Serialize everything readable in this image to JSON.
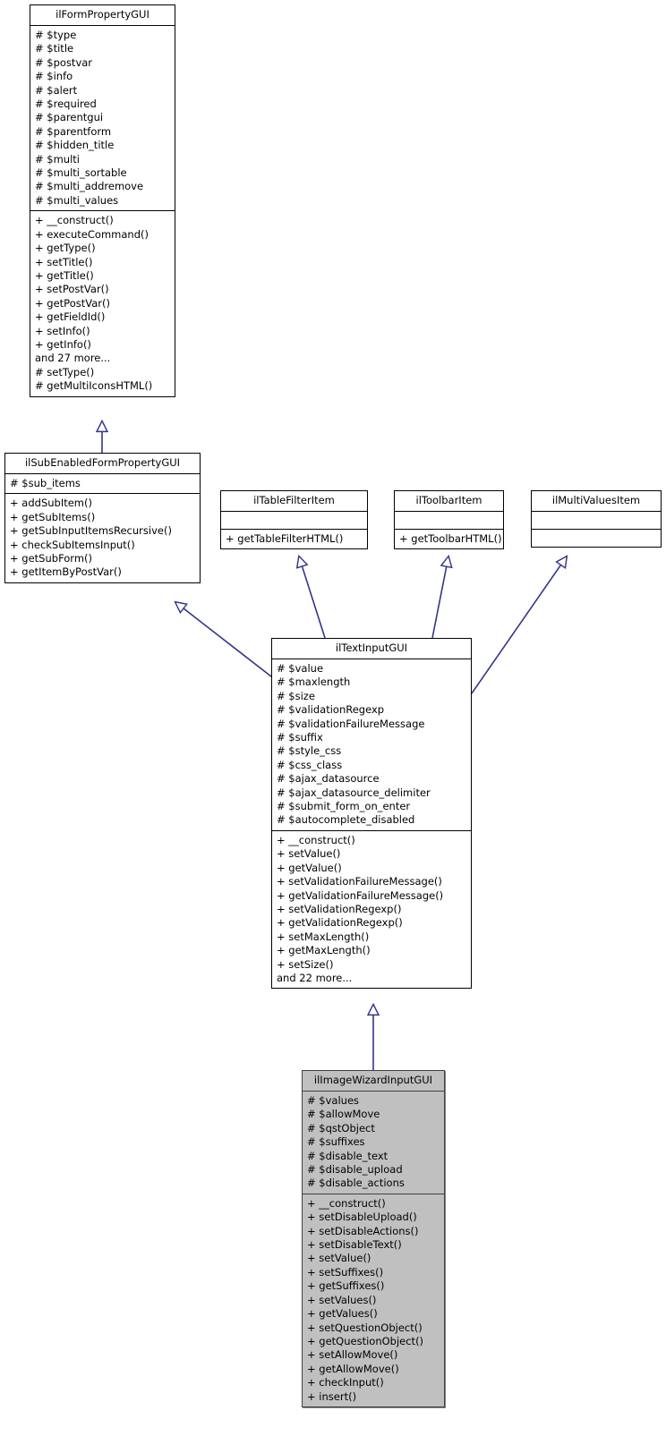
{
  "diagram": {
    "type": "uml-class-inheritance-diagram",
    "edge_color": "#34348c",
    "highlight_fill": "#c0c0c0"
  },
  "classes": [
    {
      "id": "ilFormPropertyGUI",
      "name": "ilFormPropertyGUI",
      "highlight": false,
      "attributes": [
        "# $type",
        "# $title",
        "# $postvar",
        "# $info",
        "# $alert",
        "# $required",
        "# $parentgui",
        "# $parentform",
        "# $hidden_title",
        "# $multi",
        "# $multi_sortable",
        "# $multi_addremove",
        "# $multi_values"
      ],
      "methods": [
        "+ __construct()",
        "+ executeCommand()",
        "+ getType()",
        "+ setTitle()",
        "+ getTitle()",
        "+ setPostVar()",
        "+ getPostVar()",
        "+ getFieldId()",
        "+ setInfo()",
        "+ getInfo()",
        "and 27 more...",
        "# setType()",
        "# getMultiIconsHTML()"
      ]
    },
    {
      "id": "ilSubEnabledFormPropertyGUI",
      "name": "ilSubEnabledFormPropertyGUI",
      "highlight": false,
      "attributes": [
        "# $sub_items"
      ],
      "methods": [
        "+ addSubItem()",
        "+ getSubItems()",
        "+ getSubInputItemsRecursive()",
        "+ checkSubItemsInput()",
        "+ getSubForm()",
        "+ getItemByPostVar()"
      ]
    },
    {
      "id": "ilTableFilterItem",
      "name": "ilTableFilterItem",
      "highlight": false,
      "attributes": [],
      "methods": [
        "+ getTableFilterHTML()"
      ]
    },
    {
      "id": "ilToolbarItem",
      "name": "ilToolbarItem",
      "highlight": false,
      "attributes": [],
      "methods": [
        "+ getToolbarHTML()"
      ]
    },
    {
      "id": "ilMultiValuesItem",
      "name": "ilMultiValuesItem",
      "highlight": false,
      "attributes": [],
      "methods": []
    },
    {
      "id": "ilTextInputGUI",
      "name": "ilTextInputGUI",
      "highlight": false,
      "attributes": [
        "# $value",
        "# $maxlength",
        "# $size",
        "# $validationRegexp",
        "# $validationFailureMessage",
        "# $suffix",
        "# $style_css",
        "# $css_class",
        "# $ajax_datasource",
        "# $ajax_datasource_delimiter",
        "# $submit_form_on_enter",
        "# $autocomplete_disabled"
      ],
      "methods": [
        "+ __construct()",
        "+ setValue()",
        "+ getValue()",
        "+ setValidationFailureMessage()",
        "+ getValidationFailureMessage()",
        "+ setValidationRegexp()",
        "+ getValidationRegexp()",
        "+ setMaxLength()",
        "+ getMaxLength()",
        "+ setSize()",
        "and 22 more..."
      ]
    },
    {
      "id": "ilImageWizardInputGUI",
      "name": "ilImageWizardInputGUI",
      "highlight": true,
      "attributes": [
        "# $values",
        "# $allowMove",
        "# $qstObject",
        "# $suffixes",
        "# $disable_text",
        "# $disable_upload",
        "# $disable_actions"
      ],
      "methods": [
        "+ __construct()",
        "+ setDisableUpload()",
        "+ setDisableActions()",
        "+ setDisableText()",
        "+ setValue()",
        "+ setSuffixes()",
        "+ getSuffixes()",
        "+ setValues()",
        "+ getValues()",
        "+ setQuestionObject()",
        "+ getQuestionObject()",
        "+ setAllowMove()",
        "+ getAllowMove()",
        "+ checkInput()",
        "+ insert()"
      ]
    }
  ],
  "edges": [
    {
      "from": "ilSubEnabledFormPropertyGUI",
      "to": "ilFormPropertyGUI",
      "kind": "inheritance"
    },
    {
      "from": "ilTextInputGUI",
      "to": "ilSubEnabledFormPropertyGUI",
      "kind": "inheritance"
    },
    {
      "from": "ilTextInputGUI",
      "to": "ilTableFilterItem",
      "kind": "inheritance"
    },
    {
      "from": "ilTextInputGUI",
      "to": "ilToolbarItem",
      "kind": "inheritance"
    },
    {
      "from": "ilTextInputGUI",
      "to": "ilMultiValuesItem",
      "kind": "inheritance"
    },
    {
      "from": "ilImageWizardInputGUI",
      "to": "ilTextInputGUI",
      "kind": "inheritance"
    }
  ]
}
